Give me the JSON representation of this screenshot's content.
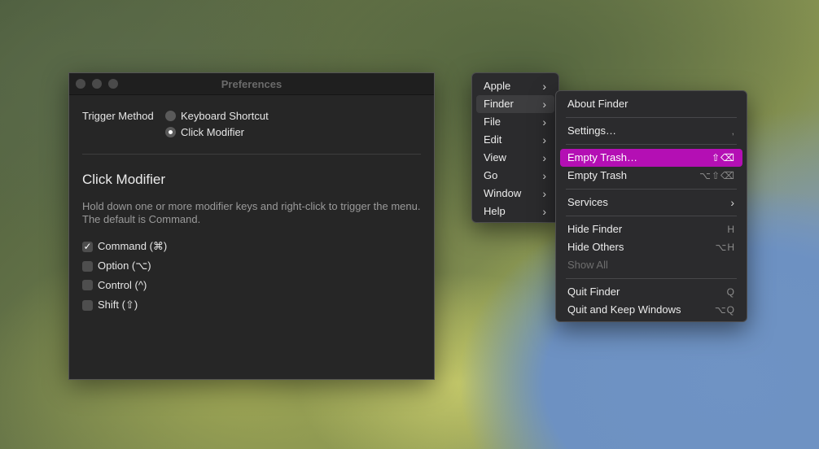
{
  "window": {
    "title": "Preferences",
    "trigger_label": "Trigger Method",
    "trigger_options": [
      {
        "label": "Keyboard Shortcut",
        "selected": false
      },
      {
        "label": "Click Modifier",
        "selected": true
      }
    ],
    "section_title": "Click Modifier",
    "description": "Hold down one or more modifier keys and right-click to trigger the menu. The default is Command.",
    "modifiers": [
      {
        "label": "Command (⌘)",
        "checked": true
      },
      {
        "label": "Option (⌥)",
        "checked": false
      },
      {
        "label": "Control (^)",
        "checked": false
      },
      {
        "label": "Shift (⇧)",
        "checked": false
      }
    ]
  },
  "menu_main": {
    "items": [
      "Apple",
      "Finder",
      "File",
      "Edit",
      "View",
      "Go",
      "Window",
      "Help"
    ],
    "selected": "Finder"
  },
  "menu_finder": {
    "about": "About Finder",
    "settings": "Settings…",
    "settings_shortcut": ",",
    "empty_trash_dots": "Empty Trash…",
    "empty_trash_dots_shortcut": "⇧⌫",
    "empty_trash": "Empty Trash",
    "empty_trash_shortcut": "⌥⇧⌫",
    "services": "Services",
    "hide_finder": "Hide Finder",
    "hide_finder_shortcut": "H",
    "hide_others": "Hide Others",
    "hide_others_shortcut": "⌥H",
    "show_all": "Show All",
    "quit_finder": "Quit Finder",
    "quit_finder_shortcut": "Q",
    "quit_keep": "Quit and Keep Windows",
    "quit_keep_shortcut": "⌥Q"
  },
  "colors": {
    "highlight": "#b40fb4",
    "menu_bg": "#2b2b2d",
    "window_bg": "#262626"
  }
}
